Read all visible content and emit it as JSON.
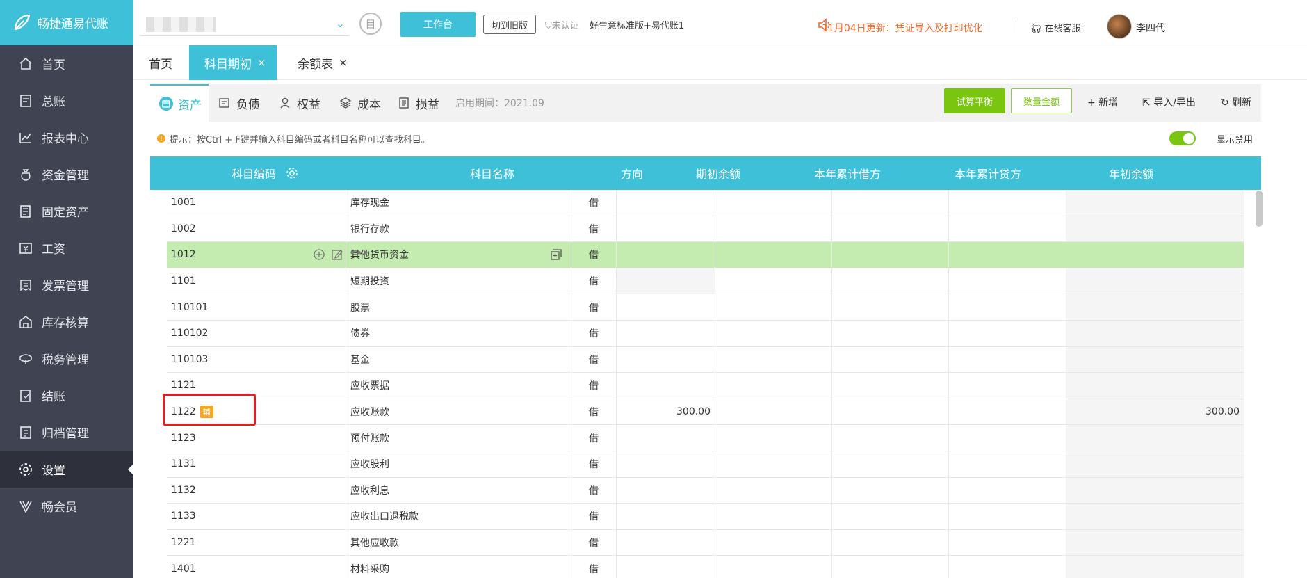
{
  "brand": {
    "name": "畅捷通易代账",
    "color": "#3ec1d8"
  },
  "sidebar": {
    "items": [
      {
        "label": "首页",
        "icon": "home-icon"
      },
      {
        "label": "总账",
        "icon": "ledger-icon"
      },
      {
        "label": "报表中心",
        "icon": "chart-icon"
      },
      {
        "label": "资金管理",
        "icon": "money-bag-icon"
      },
      {
        "label": "固定资产",
        "icon": "asset-icon"
      },
      {
        "label": "工资",
        "icon": "salary-icon"
      },
      {
        "label": "发票管理",
        "icon": "invoice-icon"
      },
      {
        "label": "库存核算",
        "icon": "warehouse-icon"
      },
      {
        "label": "税务管理",
        "icon": "tax-icon"
      },
      {
        "label": "结账",
        "icon": "checkout-icon"
      },
      {
        "label": "归档管理",
        "icon": "archive-icon"
      },
      {
        "label": "设置",
        "icon": "gear-icon",
        "active": true
      },
      {
        "label": "畅会员",
        "icon": "vip-icon"
      }
    ]
  },
  "topbar": {
    "calendar_glyph": "目",
    "workbench": "工作台",
    "switch_old": "切到旧版",
    "cert": "未认证",
    "version": "好生意标准版+易代账1",
    "update": "11月04日更新：凭证导入及打印优化",
    "support": "在线客服",
    "user": "李四代"
  },
  "page_tabs": [
    {
      "label": "首页",
      "closable": false
    },
    {
      "label": "科目期初",
      "closable": true,
      "active": true
    },
    {
      "label": "余额表",
      "closable": true
    }
  ],
  "close_glyph": "×",
  "category_tabs": [
    {
      "label": "资产",
      "icon": "asset-category-icon",
      "active": true
    },
    {
      "label": "负债",
      "icon": "liability-icon"
    },
    {
      "label": "权益",
      "icon": "equity-icon"
    },
    {
      "label": "成本",
      "icon": "cost-icon"
    },
    {
      "label": "损益",
      "icon": "profit-loss-icon"
    }
  ],
  "period": "启用期间：2021.09",
  "actions": {
    "trial_balance": "试算平衡",
    "qty_amount": "数量金额",
    "add": "新增",
    "import_export": "导入/导出",
    "refresh": "刷新"
  },
  "hint": "提示：按Ctrl + F键并输入科目编码或者科目名称可以查找科目。",
  "toggle_label": "显示禁用",
  "table": {
    "columns": [
      "科目编码",
      "科目名称",
      "方向",
      "期初余额",
      "本年累计借方",
      "本年累计贷方",
      "年初余额"
    ],
    "rows": [
      {
        "code": "1001",
        "name": "库存现金",
        "dir": "借",
        "opening": "",
        "debit": "",
        "credit": "",
        "year_open": ""
      },
      {
        "code": "1002",
        "name": "银行存款",
        "dir": "借",
        "opening": "",
        "debit": "",
        "credit": "",
        "year_open": ""
      },
      {
        "code": "1012",
        "name": "其他货币资金",
        "dir": "借",
        "opening": "",
        "debit": "",
        "credit": "",
        "year_open": "",
        "highlight": true
      },
      {
        "code": "1101",
        "name": "短期投资",
        "dir": "借",
        "opening": "",
        "debit": "",
        "credit": "",
        "year_open": "",
        "grey_opening": true
      },
      {
        "code": "110101",
        "name": "股票",
        "dir": "借",
        "opening": "",
        "debit": "",
        "credit": "",
        "year_open": ""
      },
      {
        "code": "110102",
        "name": "债券",
        "dir": "借",
        "opening": "",
        "debit": "",
        "credit": "",
        "year_open": ""
      },
      {
        "code": "110103",
        "name": "基金",
        "dir": "借",
        "opening": "",
        "debit": "",
        "credit": "",
        "year_open": ""
      },
      {
        "code": "1121",
        "name": "应收票据",
        "dir": "借",
        "opening": "",
        "debit": "",
        "credit": "",
        "year_open": ""
      },
      {
        "code": "1122",
        "badge": "辅",
        "name": "应收账款",
        "dir": "借",
        "opening": "300.00",
        "debit": "",
        "credit": "",
        "year_open": "300.00"
      },
      {
        "code": "1123",
        "name": "预付账款",
        "dir": "借",
        "opening": "",
        "debit": "",
        "credit": "",
        "year_open": ""
      },
      {
        "code": "1131",
        "name": "应收股利",
        "dir": "借",
        "opening": "",
        "debit": "",
        "credit": "",
        "year_open": ""
      },
      {
        "code": "1132",
        "name": "应收利息",
        "dir": "借",
        "opening": "",
        "debit": "",
        "credit": "",
        "year_open": ""
      },
      {
        "code": "1133",
        "name": "应收出口退税款",
        "dir": "借",
        "opening": "",
        "debit": "",
        "credit": "",
        "year_open": ""
      },
      {
        "code": "1221",
        "name": "其他应收款",
        "dir": "借",
        "opening": "",
        "debit": "",
        "credit": "",
        "year_open": ""
      },
      {
        "code": "1401",
        "name": "材料采购",
        "dir": "借",
        "opening": "",
        "debit": "",
        "credit": "",
        "year_open": ""
      }
    ]
  }
}
